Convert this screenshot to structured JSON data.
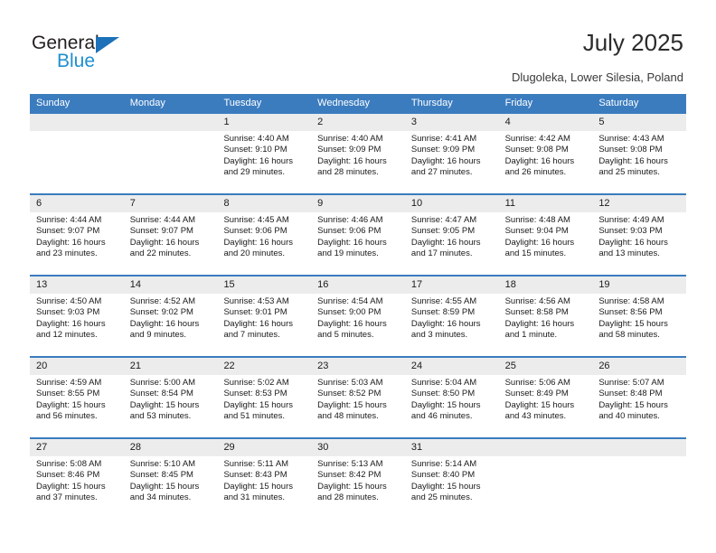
{
  "brand": {
    "name_part1": "General",
    "name_part2": "Blue",
    "color_dark": "#231f20",
    "color_blue": "#1d8fd1",
    "triangle_color": "#1d71b8"
  },
  "header": {
    "title": "July 2025",
    "subtitle": "Dlugoleka, Lower Silesia, Poland"
  },
  "theme": {
    "header_bar": "#3b7cbf",
    "day_number_band": "#ececec",
    "cell_background": "#ffffff",
    "text": "#1a1a1a"
  },
  "weekdays": [
    "Sunday",
    "Monday",
    "Tuesday",
    "Wednesday",
    "Thursday",
    "Friday",
    "Saturday"
  ],
  "weeks": [
    [
      {
        "day": "",
        "sunrise": "",
        "sunset": "",
        "daylight": "",
        "empty": true
      },
      {
        "day": "",
        "sunrise": "",
        "sunset": "",
        "daylight": "",
        "empty": true
      },
      {
        "day": "1",
        "sunrise": "Sunrise: 4:40 AM",
        "sunset": "Sunset: 9:10 PM",
        "daylight": "Daylight: 16 hours and 29 minutes."
      },
      {
        "day": "2",
        "sunrise": "Sunrise: 4:40 AM",
        "sunset": "Sunset: 9:09 PM",
        "daylight": "Daylight: 16 hours and 28 minutes."
      },
      {
        "day": "3",
        "sunrise": "Sunrise: 4:41 AM",
        "sunset": "Sunset: 9:09 PM",
        "daylight": "Daylight: 16 hours and 27 minutes."
      },
      {
        "day": "4",
        "sunrise": "Sunrise: 4:42 AM",
        "sunset": "Sunset: 9:08 PM",
        "daylight": "Daylight: 16 hours and 26 minutes."
      },
      {
        "day": "5",
        "sunrise": "Sunrise: 4:43 AM",
        "sunset": "Sunset: 9:08 PM",
        "daylight": "Daylight: 16 hours and 25 minutes."
      }
    ],
    [
      {
        "day": "6",
        "sunrise": "Sunrise: 4:44 AM",
        "sunset": "Sunset: 9:07 PM",
        "daylight": "Daylight: 16 hours and 23 minutes."
      },
      {
        "day": "7",
        "sunrise": "Sunrise: 4:44 AM",
        "sunset": "Sunset: 9:07 PM",
        "daylight": "Daylight: 16 hours and 22 minutes."
      },
      {
        "day": "8",
        "sunrise": "Sunrise: 4:45 AM",
        "sunset": "Sunset: 9:06 PM",
        "daylight": "Daylight: 16 hours and 20 minutes."
      },
      {
        "day": "9",
        "sunrise": "Sunrise: 4:46 AM",
        "sunset": "Sunset: 9:06 PM",
        "daylight": "Daylight: 16 hours and 19 minutes."
      },
      {
        "day": "10",
        "sunrise": "Sunrise: 4:47 AM",
        "sunset": "Sunset: 9:05 PM",
        "daylight": "Daylight: 16 hours and 17 minutes."
      },
      {
        "day": "11",
        "sunrise": "Sunrise: 4:48 AM",
        "sunset": "Sunset: 9:04 PM",
        "daylight": "Daylight: 16 hours and 15 minutes."
      },
      {
        "day": "12",
        "sunrise": "Sunrise: 4:49 AM",
        "sunset": "Sunset: 9:03 PM",
        "daylight": "Daylight: 16 hours and 13 minutes."
      }
    ],
    [
      {
        "day": "13",
        "sunrise": "Sunrise: 4:50 AM",
        "sunset": "Sunset: 9:03 PM",
        "daylight": "Daylight: 16 hours and 12 minutes."
      },
      {
        "day": "14",
        "sunrise": "Sunrise: 4:52 AM",
        "sunset": "Sunset: 9:02 PM",
        "daylight": "Daylight: 16 hours and 9 minutes."
      },
      {
        "day": "15",
        "sunrise": "Sunrise: 4:53 AM",
        "sunset": "Sunset: 9:01 PM",
        "daylight": "Daylight: 16 hours and 7 minutes."
      },
      {
        "day": "16",
        "sunrise": "Sunrise: 4:54 AM",
        "sunset": "Sunset: 9:00 PM",
        "daylight": "Daylight: 16 hours and 5 minutes."
      },
      {
        "day": "17",
        "sunrise": "Sunrise: 4:55 AM",
        "sunset": "Sunset: 8:59 PM",
        "daylight": "Daylight: 16 hours and 3 minutes."
      },
      {
        "day": "18",
        "sunrise": "Sunrise: 4:56 AM",
        "sunset": "Sunset: 8:58 PM",
        "daylight": "Daylight: 16 hours and 1 minute."
      },
      {
        "day": "19",
        "sunrise": "Sunrise: 4:58 AM",
        "sunset": "Sunset: 8:56 PM",
        "daylight": "Daylight: 15 hours and 58 minutes."
      }
    ],
    [
      {
        "day": "20",
        "sunrise": "Sunrise: 4:59 AM",
        "sunset": "Sunset: 8:55 PM",
        "daylight": "Daylight: 15 hours and 56 minutes."
      },
      {
        "day": "21",
        "sunrise": "Sunrise: 5:00 AM",
        "sunset": "Sunset: 8:54 PM",
        "daylight": "Daylight: 15 hours and 53 minutes."
      },
      {
        "day": "22",
        "sunrise": "Sunrise: 5:02 AM",
        "sunset": "Sunset: 8:53 PM",
        "daylight": "Daylight: 15 hours and 51 minutes."
      },
      {
        "day": "23",
        "sunrise": "Sunrise: 5:03 AM",
        "sunset": "Sunset: 8:52 PM",
        "daylight": "Daylight: 15 hours and 48 minutes."
      },
      {
        "day": "24",
        "sunrise": "Sunrise: 5:04 AM",
        "sunset": "Sunset: 8:50 PM",
        "daylight": "Daylight: 15 hours and 46 minutes."
      },
      {
        "day": "25",
        "sunrise": "Sunrise: 5:06 AM",
        "sunset": "Sunset: 8:49 PM",
        "daylight": "Daylight: 15 hours and 43 minutes."
      },
      {
        "day": "26",
        "sunrise": "Sunrise: 5:07 AM",
        "sunset": "Sunset: 8:48 PM",
        "daylight": "Daylight: 15 hours and 40 minutes."
      }
    ],
    [
      {
        "day": "27",
        "sunrise": "Sunrise: 5:08 AM",
        "sunset": "Sunset: 8:46 PM",
        "daylight": "Daylight: 15 hours and 37 minutes."
      },
      {
        "day": "28",
        "sunrise": "Sunrise: 5:10 AM",
        "sunset": "Sunset: 8:45 PM",
        "daylight": "Daylight: 15 hours and 34 minutes."
      },
      {
        "day": "29",
        "sunrise": "Sunrise: 5:11 AM",
        "sunset": "Sunset: 8:43 PM",
        "daylight": "Daylight: 15 hours and 31 minutes."
      },
      {
        "day": "30",
        "sunrise": "Sunrise: 5:13 AM",
        "sunset": "Sunset: 8:42 PM",
        "daylight": "Daylight: 15 hours and 28 minutes."
      },
      {
        "day": "31",
        "sunrise": "Sunrise: 5:14 AM",
        "sunset": "Sunset: 8:40 PM",
        "daylight": "Daylight: 15 hours and 25 minutes."
      },
      {
        "day": "",
        "sunrise": "",
        "sunset": "",
        "daylight": "",
        "empty": true
      },
      {
        "day": "",
        "sunrise": "",
        "sunset": "",
        "daylight": "",
        "empty": true
      }
    ]
  ]
}
